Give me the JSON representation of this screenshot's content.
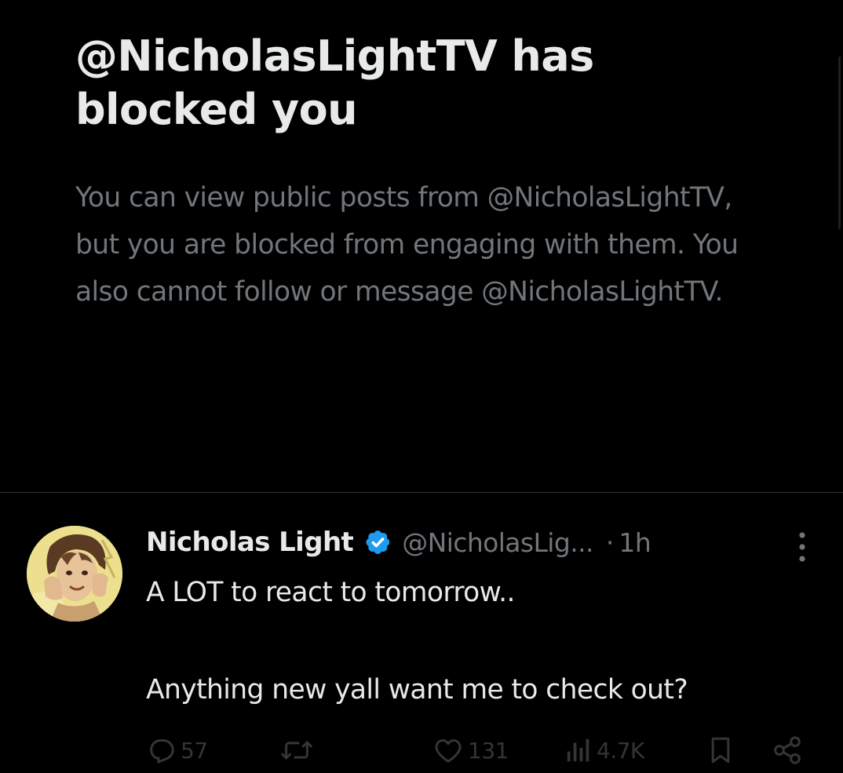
{
  "block_notice": {
    "title": "@NicholasLightTV has blocked you",
    "description": "You can view public posts from @NicholasLightTV, but you are blocked from engaging with them. You also cannot follow or message @NicholasLightTV."
  },
  "post": {
    "author_name": "Nicholas Light",
    "verified": true,
    "handle": "@NicholasLig...",
    "separator": "·",
    "time": "1h",
    "text_line_1": "A LOT to react to tomorrow..",
    "text_line_2": "Anything new yall want me to check out?",
    "actions": {
      "reply_count": "57",
      "repost_count": "",
      "like_count": "131",
      "view_count": "4.7K"
    }
  },
  "colors": {
    "background": "#000000",
    "primary_text": "#e7e9ea",
    "secondary_text": "#71767b",
    "divider": "#2f3336",
    "verified_badge": "#1d9bf0"
  },
  "icons": {
    "verified": "verified-badge-icon",
    "more": "more-vertical-icon",
    "reply": "reply-icon",
    "repost": "repost-icon",
    "like": "heart-icon",
    "views": "views-icon",
    "bookmark": "bookmark-icon",
    "share": "share-icon"
  }
}
